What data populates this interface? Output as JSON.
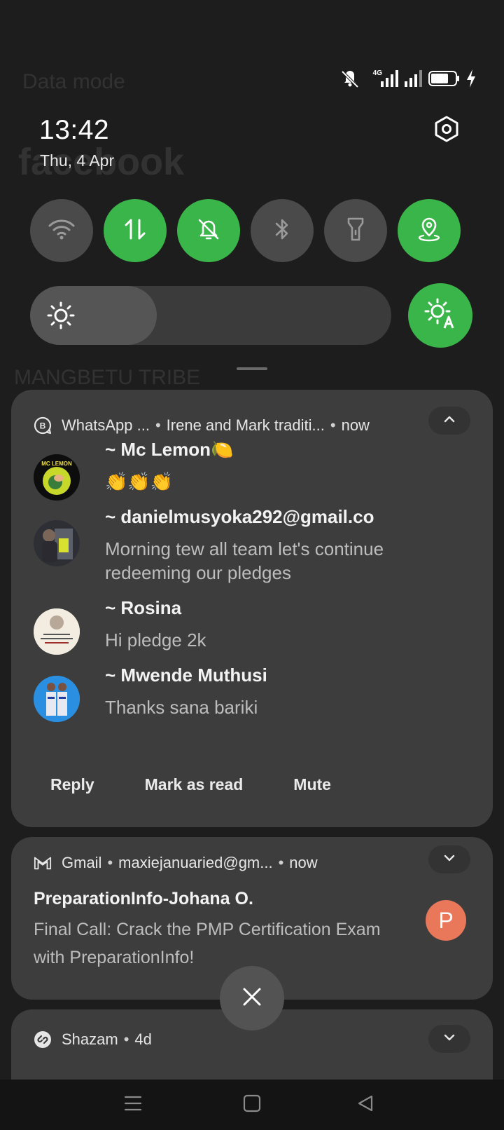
{
  "background_app": {
    "data_mode_text": "Data mode",
    "logo_text": "facebook",
    "group_text": "MANGBETU TRIBE"
  },
  "status_bar": {
    "network_type": "4G",
    "icons": [
      "vibrate-off-icon",
      "signal-4g-icon",
      "signal-icon",
      "battery-icon",
      "charging-icon"
    ]
  },
  "header": {
    "time": "13:42",
    "date": "Thu, 4 Apr",
    "settings_icon": "settings-icon"
  },
  "quick_tiles": [
    {
      "name": "wifi",
      "icon": "wifi-icon",
      "state": "off"
    },
    {
      "name": "mobile-data",
      "icon": "data-transfer-icon",
      "state": "on"
    },
    {
      "name": "silent",
      "icon": "bell-off-icon",
      "state": "on"
    },
    {
      "name": "bluetooth",
      "icon": "bluetooth-icon",
      "state": "off"
    },
    {
      "name": "flashlight",
      "icon": "flashlight-icon",
      "state": "off"
    },
    {
      "name": "location",
      "icon": "location-icon",
      "state": "on"
    }
  ],
  "brightness": {
    "level_fraction": 0.35,
    "auto_icon": "auto-brightness-icon"
  },
  "notifications": {
    "whatsapp": {
      "app": "WhatsApp ...",
      "conversation": "Irene and Mark traditi...",
      "time": "now",
      "messages": [
        {
          "sender": "~ Mc Lemon🍋",
          "text": "👏👏👏"
        },
        {
          "sender": "~ danielmusyoka292@gmail.co",
          "text": "Morning tew all team let's continue redeeming our pledges"
        },
        {
          "sender": "~ Rosina",
          "text": "Hi pledge 2k"
        },
        {
          "sender": "~ Mwende Muthusi",
          "text": "Thanks sana bariki"
        }
      ],
      "actions": [
        "Reply",
        "Mark as read",
        "Mute"
      ]
    },
    "gmail": {
      "app": "Gmail",
      "account": "maxiejanuaried@gm...",
      "time": "now",
      "subject": "PreparationInfo-Johana O.",
      "body": "Final Call: Crack the PMP Certification Exam with PreparationInfo!",
      "avatar_letter": "P"
    },
    "shazam": {
      "app": "Shazam",
      "time": "4d"
    }
  },
  "colors": {
    "accent_green": "#3ab54a",
    "card_bg": "#3d3d3d",
    "gmail_avatar": "#e9785a"
  }
}
